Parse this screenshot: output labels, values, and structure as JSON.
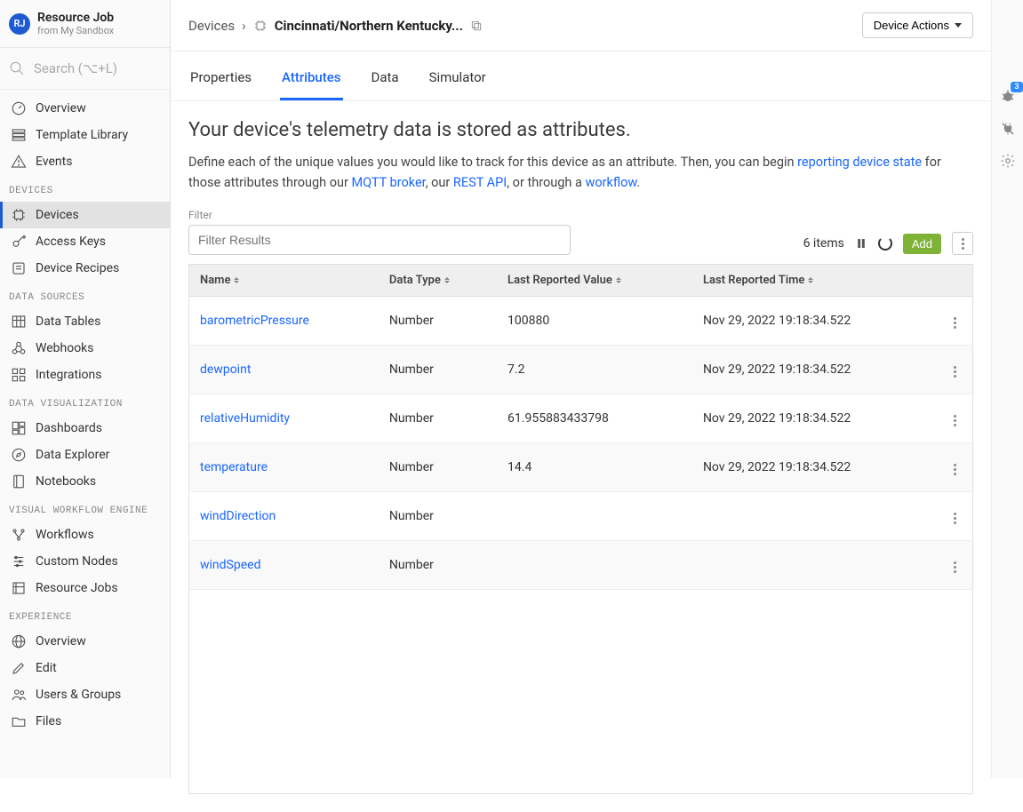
{
  "header": {
    "avatar_initials": "RJ",
    "title": "Resource Job",
    "subtitle": "from My Sandbox"
  },
  "search": {
    "placeholder": "Search (⌥+L)"
  },
  "sidebar": {
    "top": [
      {
        "label": "Overview"
      },
      {
        "label": "Template Library"
      },
      {
        "label": "Events"
      }
    ],
    "sections": [
      {
        "label": "DEVICES",
        "items": [
          {
            "label": "Devices",
            "active": true
          },
          {
            "label": "Access Keys"
          },
          {
            "label": "Device Recipes"
          }
        ]
      },
      {
        "label": "DATA SOURCES",
        "items": [
          {
            "label": "Data Tables"
          },
          {
            "label": "Webhooks"
          },
          {
            "label": "Integrations"
          }
        ]
      },
      {
        "label": "DATA VISUALIZATION",
        "items": [
          {
            "label": "Dashboards"
          },
          {
            "label": "Data Explorer"
          },
          {
            "label": "Notebooks"
          }
        ]
      },
      {
        "label": "VISUAL WORKFLOW ENGINE",
        "items": [
          {
            "label": "Workflows"
          },
          {
            "label": "Custom Nodes"
          },
          {
            "label": "Resource Jobs"
          }
        ]
      },
      {
        "label": "EXPERIENCE",
        "items": [
          {
            "label": "Overview"
          },
          {
            "label": "Edit"
          },
          {
            "label": "Users & Groups"
          },
          {
            "label": "Files"
          }
        ]
      }
    ]
  },
  "breadcrumb": {
    "root": "Devices",
    "current": "Cincinnati/Northern Kentucky..."
  },
  "actions": {
    "device_actions": "Device Actions"
  },
  "tabs": [
    {
      "label": "Properties"
    },
    {
      "label": "Attributes",
      "active": true
    },
    {
      "label": "Data"
    },
    {
      "label": "Simulator"
    }
  ],
  "content": {
    "heading": "Your device's telemetry data is stored as attributes.",
    "desc_pre": "Define each of the unique values you would like to track for this device as an attribute. Then, you can begin ",
    "link_reporting": "reporting device state",
    "desc_mid1": " for those attributes through our ",
    "link_mqtt": "MQTT broker",
    "desc_mid2": ", our ",
    "link_rest": "REST API",
    "desc_mid3": ", or through a ",
    "link_workflow": "workflow",
    "desc_end": "."
  },
  "filter": {
    "label": "Filter",
    "placeholder": "Filter Results"
  },
  "toolbar": {
    "count": "6 items",
    "add": "Add"
  },
  "columns": {
    "name": "Name",
    "type": "Data Type",
    "value": "Last Reported Value",
    "time": "Last Reported Time"
  },
  "rows": [
    {
      "name": "barometricPressure",
      "type": "Number",
      "value": "100880",
      "time": "Nov 29, 2022 19:18:34.522"
    },
    {
      "name": "dewpoint",
      "type": "Number",
      "value": "7.2",
      "time": "Nov 29, 2022 19:18:34.522"
    },
    {
      "name": "relativeHumidity",
      "type": "Number",
      "value": "61.955883433798",
      "time": "Nov 29, 2022 19:18:34.522"
    },
    {
      "name": "temperature",
      "type": "Number",
      "value": "14.4",
      "time": "Nov 29, 2022 19:18:34.522"
    },
    {
      "name": "windDirection",
      "type": "Number",
      "value": "",
      "time": ""
    },
    {
      "name": "windSpeed",
      "type": "Number",
      "value": "",
      "time": ""
    }
  ],
  "rail": {
    "badge": "3"
  }
}
